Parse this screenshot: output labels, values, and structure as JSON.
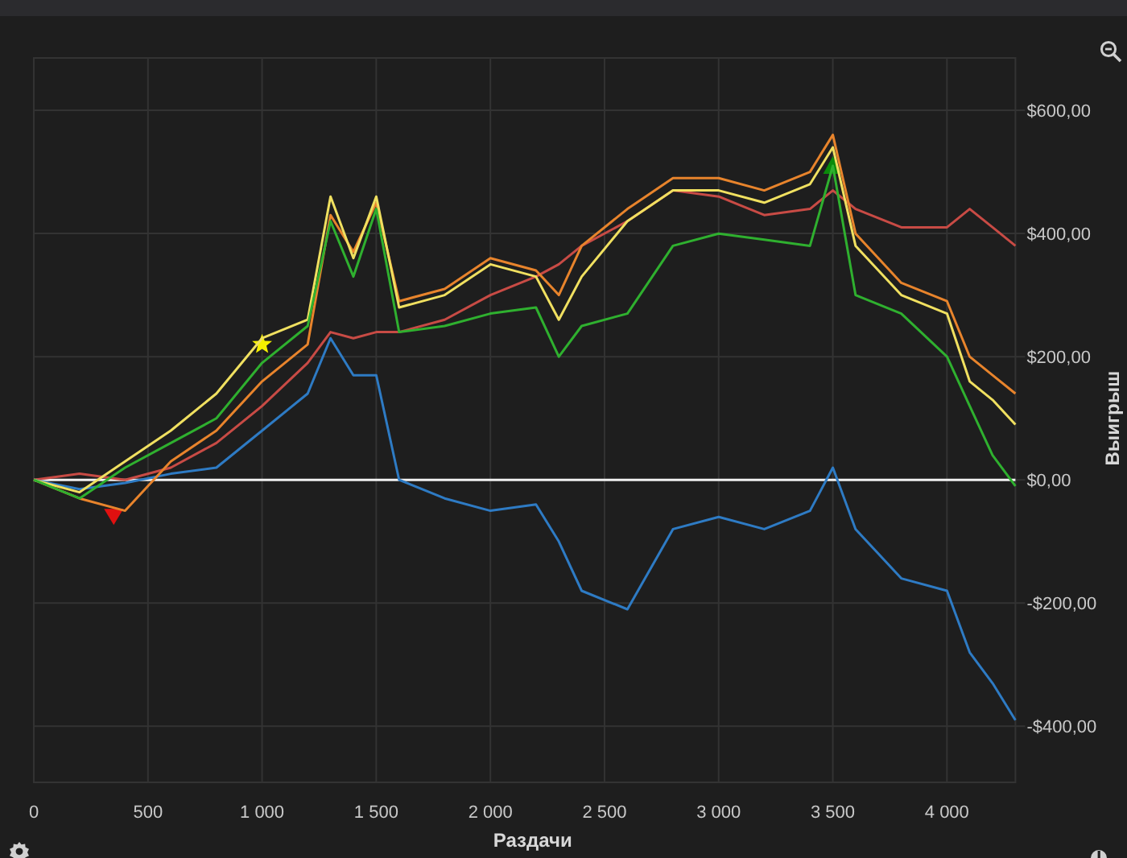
{
  "chart_data": {
    "type": "line",
    "xlabel": "Раздачи",
    "ylabel": "Выигрыш",
    "x": [
      0,
      200,
      400,
      600,
      800,
      1000,
      1200,
      1300,
      1400,
      1500,
      1600,
      1800,
      2000,
      2200,
      2300,
      2400,
      2600,
      2800,
      3000,
      3200,
      3400,
      3500,
      3600,
      3800,
      4000,
      4100,
      4200,
      4300
    ],
    "series": [
      {
        "color": "#c84b45",
        "values": [
          0,
          10,
          0,
          20,
          60,
          120,
          190,
          240,
          230,
          240,
          240,
          260,
          300,
          330,
          350,
          380,
          420,
          470,
          460,
          430,
          440,
          470,
          440,
          410,
          410,
          440,
          410,
          380
        ]
      },
      {
        "color": "#2e7bc4",
        "values": [
          0,
          -15,
          -5,
          10,
          20,
          80,
          140,
          230,
          170,
          170,
          0,
          -30,
          -50,
          -40,
          -100,
          -180,
          -210,
          -80,
          -60,
          -80,
          -50,
          20,
          -80,
          -160,
          -180,
          -280,
          -330,
          -390
        ]
      },
      {
        "color": "#e8842c",
        "values": [
          0,
          -30,
          -50,
          30,
          80,
          160,
          220,
          430,
          370,
          450,
          290,
          310,
          360,
          340,
          300,
          380,
          440,
          490,
          490,
          470,
          500,
          560,
          400,
          320,
          290,
          200,
          170,
          140
        ]
      },
      {
        "color": "#f0e060",
        "values": [
          0,
          -20,
          30,
          80,
          140,
          230,
          260,
          460,
          360,
          460,
          280,
          300,
          350,
          330,
          260,
          330,
          420,
          470,
          470,
          450,
          480,
          540,
          380,
          300,
          270,
          160,
          130,
          90
        ]
      },
      {
        "color": "#2fb02f",
        "values": [
          0,
          -30,
          20,
          60,
          100,
          190,
          250,
          420,
          330,
          440,
          240,
          250,
          270,
          280,
          200,
          250,
          270,
          380,
          400,
          390,
          380,
          510,
          300,
          270,
          200,
          120,
          40,
          -10
        ]
      }
    ],
    "xlim": [
      0,
      4300
    ],
    "ylim": [
      -491,
      685
    ],
    "xticks": [
      {
        "value": 0,
        "label": "0"
      },
      {
        "value": 500,
        "label": "500"
      },
      {
        "value": 1000,
        "label": "1 000"
      },
      {
        "value": 1500,
        "label": "1 500"
      },
      {
        "value": 2000,
        "label": "2 000"
      },
      {
        "value": 2500,
        "label": "2 500"
      },
      {
        "value": 3000,
        "label": "3 000"
      },
      {
        "value": 3500,
        "label": "3 500"
      },
      {
        "value": 4000,
        "label": "4 000"
      }
    ],
    "yticks": [
      {
        "value": -400,
        "label": "-$400,00"
      },
      {
        "value": -200,
        "label": "-$200,00"
      },
      {
        "value": 0,
        "label": "$0,00"
      },
      {
        "value": 200,
        "label": "$200,00"
      },
      {
        "value": 400,
        "label": "$400,00"
      },
      {
        "value": 600,
        "label": "$600,00"
      }
    ],
    "grid": true
  },
  "markers": [
    {
      "kind": "down",
      "color": "#e01010"
    },
    {
      "kind": "star",
      "color": "#f5f000"
    },
    {
      "kind": "up",
      "color": "#0a8a0a"
    }
  ]
}
